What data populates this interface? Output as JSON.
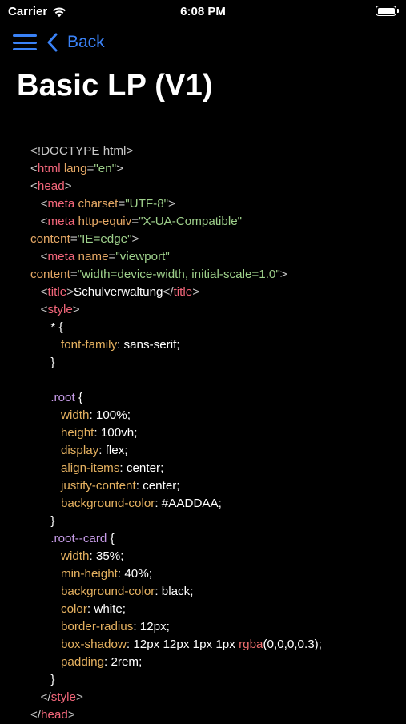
{
  "status_bar": {
    "carrier": "Carrier",
    "time": "6:08 PM",
    "icons": [
      "wifi-icon",
      "battery-icon"
    ]
  },
  "nav": {
    "menu_icon": "hamburger-menu-icon",
    "back_label": "Back",
    "back_icon": "chevron-left-icon",
    "accent_color": "#3a82f7"
  },
  "page": {
    "title": "Basic LP (V1)"
  },
  "theme": {
    "background": "#000000",
    "tag_color": "#f2667a",
    "attr_color": "#e5a865",
    "string_color": "#9ed08b",
    "selector_color": "#c79ce8",
    "property_color": "#e5b160"
  },
  "code": {
    "lines": [
      [
        {
          "t": "<!DOCTYPE html>",
          "c": "punct"
        }
      ],
      [
        {
          "t": "<",
          "c": "punct"
        },
        {
          "t": "html",
          "c": "tag"
        },
        {
          "t": " ",
          "c": "text"
        },
        {
          "t": "lang",
          "c": "attr"
        },
        {
          "t": "=",
          "c": "punct"
        },
        {
          "t": "\"en\"",
          "c": "string"
        },
        {
          "t": ">",
          "c": "punct"
        }
      ],
      [
        {
          "t": "<",
          "c": "punct"
        },
        {
          "t": "head",
          "c": "tag"
        },
        {
          "t": ">",
          "c": "punct"
        }
      ],
      [
        {
          "t": "   <",
          "c": "punct"
        },
        {
          "t": "meta",
          "c": "tag"
        },
        {
          "t": " ",
          "c": "text"
        },
        {
          "t": "charset",
          "c": "attr"
        },
        {
          "t": "=",
          "c": "punct"
        },
        {
          "t": "\"UTF-8\"",
          "c": "string"
        },
        {
          "t": ">",
          "c": "punct"
        }
      ],
      [
        {
          "t": "   <",
          "c": "punct"
        },
        {
          "t": "meta",
          "c": "tag"
        },
        {
          "t": " ",
          "c": "text"
        },
        {
          "t": "http-equiv",
          "c": "attr"
        },
        {
          "t": "=",
          "c": "punct"
        },
        {
          "t": "\"X-UA-Compatible\"",
          "c": "string"
        }
      ],
      [
        {
          "t": "content",
          "c": "attr"
        },
        {
          "t": "=",
          "c": "punct"
        },
        {
          "t": "\"IE=edge\"",
          "c": "string"
        },
        {
          "t": ">",
          "c": "punct"
        }
      ],
      [
        {
          "t": "   <",
          "c": "punct"
        },
        {
          "t": "meta",
          "c": "tag"
        },
        {
          "t": " ",
          "c": "text"
        },
        {
          "t": "name",
          "c": "attr"
        },
        {
          "t": "=",
          "c": "punct"
        },
        {
          "t": "\"viewport\"",
          "c": "string"
        }
      ],
      [
        {
          "t": "content",
          "c": "attr"
        },
        {
          "t": "=",
          "c": "punct"
        },
        {
          "t": "\"width=device-width, initial-scale=1.0\"",
          "c": "string"
        },
        {
          "t": ">",
          "c": "punct"
        }
      ],
      [
        {
          "t": "   <",
          "c": "punct"
        },
        {
          "t": "title",
          "c": "tag"
        },
        {
          "t": ">",
          "c": "punct"
        },
        {
          "t": "Schulverwaltung",
          "c": "text"
        },
        {
          "t": "</",
          "c": "punct"
        },
        {
          "t": "title",
          "c": "tag"
        },
        {
          "t": ">",
          "c": "punct"
        }
      ],
      [
        {
          "t": "   <",
          "c": "punct"
        },
        {
          "t": "style",
          "c": "tag"
        },
        {
          "t": ">",
          "c": "punct"
        }
      ],
      [
        {
          "t": "      * {",
          "c": "text"
        }
      ],
      [
        {
          "t": "         ",
          "c": "text"
        },
        {
          "t": "font-family",
          "c": "prop"
        },
        {
          "t": ": sans-serif;",
          "c": "text"
        }
      ],
      [
        {
          "t": "      }",
          "c": "text"
        }
      ],
      [
        {
          "t": "",
          "c": "text"
        }
      ],
      [
        {
          "t": "      ",
          "c": "text"
        },
        {
          "t": ".root",
          "c": "sel"
        },
        {
          "t": " {",
          "c": "text"
        }
      ],
      [
        {
          "t": "         ",
          "c": "text"
        },
        {
          "t": "width",
          "c": "prop"
        },
        {
          "t": ": 100%;",
          "c": "text"
        }
      ],
      [
        {
          "t": "         ",
          "c": "text"
        },
        {
          "t": "height",
          "c": "prop"
        },
        {
          "t": ": 100vh;",
          "c": "text"
        }
      ],
      [
        {
          "t": "         ",
          "c": "text"
        },
        {
          "t": "display",
          "c": "prop"
        },
        {
          "t": ": flex;",
          "c": "text"
        }
      ],
      [
        {
          "t": "         ",
          "c": "text"
        },
        {
          "t": "align-items",
          "c": "prop"
        },
        {
          "t": ": center;",
          "c": "text"
        }
      ],
      [
        {
          "t": "         ",
          "c": "text"
        },
        {
          "t": "justify-content",
          "c": "prop"
        },
        {
          "t": ": center;",
          "c": "text"
        }
      ],
      [
        {
          "t": "         ",
          "c": "text"
        },
        {
          "t": "background-color",
          "c": "prop"
        },
        {
          "t": ": #AADDAA;",
          "c": "text"
        }
      ],
      [
        {
          "t": "      }",
          "c": "text"
        }
      ],
      [
        {
          "t": "      ",
          "c": "text"
        },
        {
          "t": ".root--card",
          "c": "sel"
        },
        {
          "t": " {",
          "c": "text"
        }
      ],
      [
        {
          "t": "         ",
          "c": "text"
        },
        {
          "t": "width",
          "c": "prop"
        },
        {
          "t": ": 35%;",
          "c": "text"
        }
      ],
      [
        {
          "t": "         ",
          "c": "text"
        },
        {
          "t": "min-height",
          "c": "prop"
        },
        {
          "t": ": 40%;",
          "c": "text"
        }
      ],
      [
        {
          "t": "         ",
          "c": "text"
        },
        {
          "t": "background-color",
          "c": "prop"
        },
        {
          "t": ": black;",
          "c": "text"
        }
      ],
      [
        {
          "t": "         ",
          "c": "text"
        },
        {
          "t": "color",
          "c": "prop"
        },
        {
          "t": ": white;",
          "c": "text"
        }
      ],
      [
        {
          "t": "         ",
          "c": "text"
        },
        {
          "t": "border-radius",
          "c": "prop"
        },
        {
          "t": ": 12px;",
          "c": "text"
        }
      ],
      [
        {
          "t": "         ",
          "c": "text"
        },
        {
          "t": "box-shadow",
          "c": "prop"
        },
        {
          "t": ": 12px 12px 1px 1px ",
          "c": "text"
        },
        {
          "t": "rgba",
          "c": "func"
        },
        {
          "t": "(0,0,0,0.3);",
          "c": "text"
        }
      ],
      [
        {
          "t": "         ",
          "c": "text"
        },
        {
          "t": "padding",
          "c": "prop"
        },
        {
          "t": ": 2rem;",
          "c": "text"
        }
      ],
      [
        {
          "t": "      }",
          "c": "text"
        }
      ],
      [
        {
          "t": "   </",
          "c": "punct"
        },
        {
          "t": "style",
          "c": "tag"
        },
        {
          "t": ">",
          "c": "punct"
        }
      ],
      [
        {
          "t": "</",
          "c": "punct"
        },
        {
          "t": "head",
          "c": "tag"
        },
        {
          "t": ">",
          "c": "punct"
        }
      ]
    ]
  }
}
